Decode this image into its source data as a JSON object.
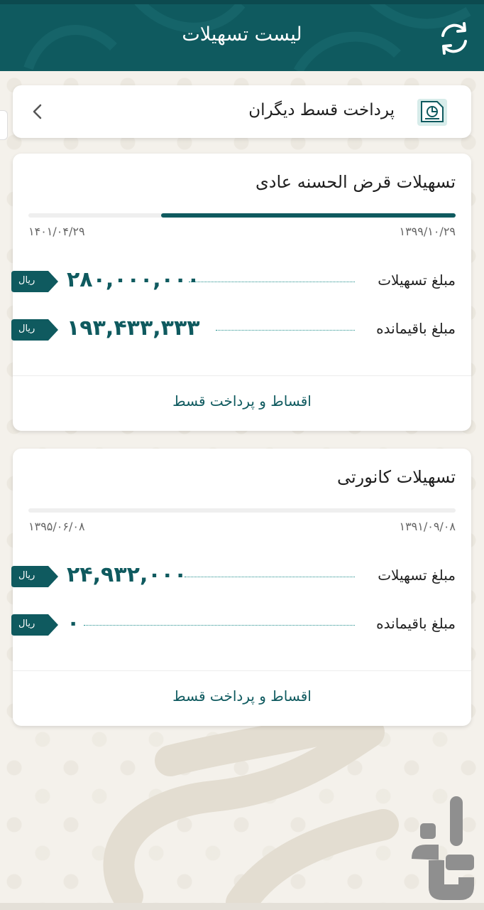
{
  "app_bar": {
    "title": "لیست تسهیلات"
  },
  "other_payment": {
    "label": "پرداخت قسط دیگران"
  },
  "currency_label": "ریال",
  "loans": [
    {
      "title": "تسهیلات قرض الحسنه عادی",
      "start_date": "۱۳۹۹/۱۰/۲۹",
      "end_date": "۱۴۰۱/۰۴/۲۹",
      "progress_fraction": 0.69,
      "amount_label": "مبلغ تسهیلات",
      "amount_value": "۲۸۰,۰۰۰,۰۰۰",
      "remaining_label": "مبلغ باقیمانده",
      "remaining_value": "۱۹۳,۴۳۳,۳۳۳",
      "installments_link": "اقساط و پرداخت قسط"
    },
    {
      "title": "تسهیلات کانورتی",
      "start_date": "۱۳۹۱/۰۹/۰۸",
      "end_date": "۱۳۹۵/۰۶/۰۸",
      "progress_fraction": 0,
      "amount_label": "مبلغ تسهیلات",
      "amount_value": "۲۴,۹۳۲,۰۰۰",
      "remaining_label": "مبلغ باقیمانده",
      "remaining_value": "۰",
      "installments_link": "اقساط و پرداخت قسط"
    }
  ],
  "colors": {
    "primary": "#0f5a5f",
    "accent_line": "#1c8c8a",
    "background": "#f4f1eb"
  },
  "icons": {
    "refresh": "refresh-icon",
    "payment": "receipt-chart-icon",
    "chevron": "chevron-left-icon"
  }
}
